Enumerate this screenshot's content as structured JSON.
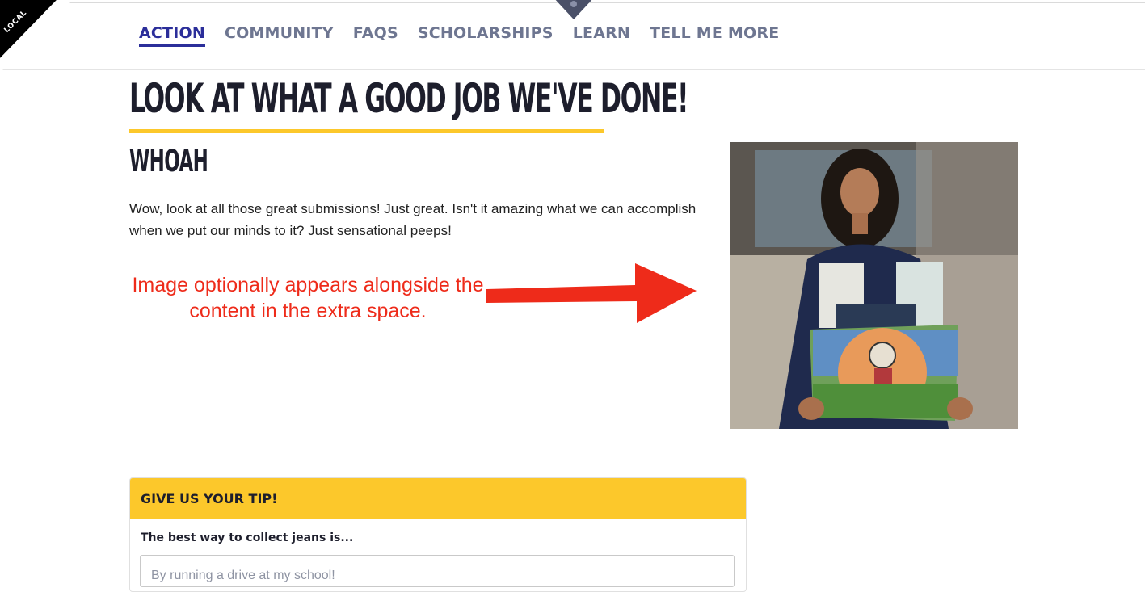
{
  "corner_badge": {
    "label": "LOCAL"
  },
  "nav": {
    "items": [
      {
        "label": "ACTION",
        "active": true
      },
      {
        "label": "COMMUNITY",
        "active": false
      },
      {
        "label": "FAQS",
        "active": false
      },
      {
        "label": "SCHOLARSHIPS",
        "active": false
      },
      {
        "label": "LEARN",
        "active": false
      },
      {
        "label": "TELL ME MORE",
        "active": false
      }
    ]
  },
  "page": {
    "title": "LOOK AT WHAT A GOOD JOB WE'VE DONE!",
    "subtitle": "WHOAH",
    "body": "Wow, look at all those great submissions! Just great. Isn't it amazing what we can accomplish when we put our minds to it? Just sensational peeps!"
  },
  "annotation": {
    "text": "Image optionally appears alongside the content in the extra space.",
    "color": "#ee2b1a"
  },
  "tip_form": {
    "header": "GIVE US YOUR TIP!",
    "question": "The best way to collect jeans is...",
    "placeholder": "By running a drive at my school!"
  },
  "colors": {
    "accent_yellow": "#fcc82b",
    "nav_active": "#2b2e9a",
    "nav_inactive": "#6e7691",
    "dark_text": "#1d1e2c"
  }
}
